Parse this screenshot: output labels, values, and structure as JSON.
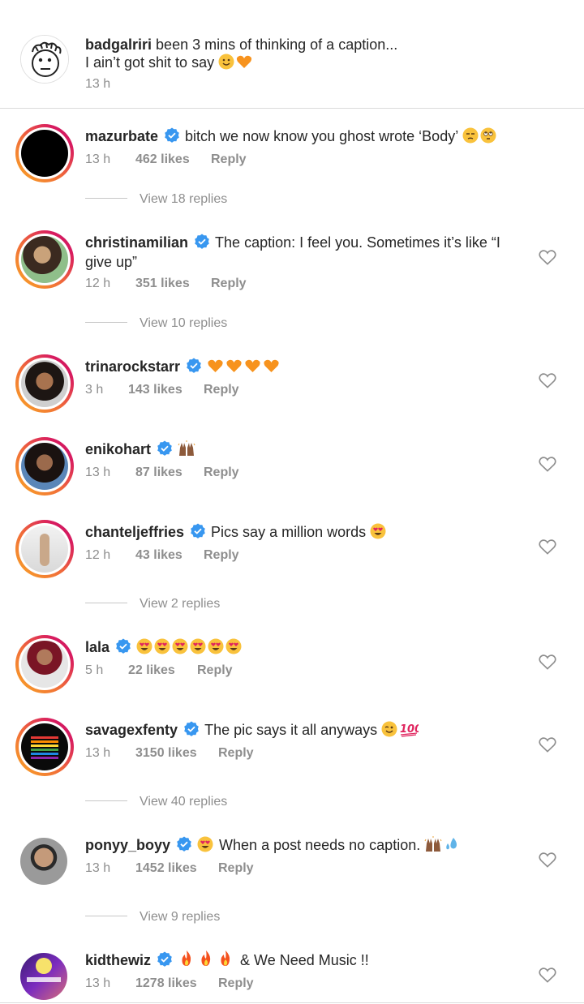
{
  "caption": {
    "username": "badgalriri",
    "text_line1": "been 3 mins of thinking of a caption...",
    "text_line2": "I ain’t got shit to say",
    "time": "13 h",
    "avatar_icon": "cartoon-face-icon"
  },
  "comments": [
    {
      "username": "mazurbate",
      "text": "bitch we now know you ghost wrote ‘Body’",
      "time": "13 h",
      "likes": "462 likes",
      "reply": "Reply",
      "view_replies": "View 18 replies",
      "emojis": [
        "unamused-face-icon",
        "eye-roll-face-icon"
      ]
    },
    {
      "username": "christinamilian",
      "text_line1": "The caption: I feel you. Sometimes it’s like “I",
      "text_line2": "give up”",
      "time": "12 h",
      "likes": "351 likes",
      "reply": "Reply",
      "view_replies": "View 10 replies"
    },
    {
      "username": "trinarockstarr",
      "text": "",
      "time": "3 h",
      "likes": "143 likes",
      "reply": "Reply",
      "emojis": [
        "orange-heart-icon",
        "orange-heart-icon",
        "orange-heart-icon",
        "orange-heart-icon"
      ]
    },
    {
      "username": "enikohart",
      "text": "",
      "time": "13 h",
      "likes": "87 likes",
      "reply": "Reply",
      "emojis": [
        "raised-hands-icon"
      ]
    },
    {
      "username": "chanteljeffries",
      "text": "Pics say a million words",
      "time": "12 h",
      "likes": "43 likes",
      "reply": "Reply",
      "view_replies": "View 2 replies",
      "emojis": [
        "heart-eyes-face-icon"
      ]
    },
    {
      "username": "lala",
      "text": "",
      "time": "5 h",
      "likes": "22 likes",
      "reply": "Reply",
      "emojis": [
        "heart-eyes-face-icon",
        "heart-eyes-face-icon",
        "heart-eyes-face-icon",
        "heart-eyes-face-icon",
        "heart-eyes-face-icon",
        "heart-eyes-face-icon"
      ]
    },
    {
      "username": "savagexfenty",
      "text": "The pic says it all anyways",
      "time": "13 h",
      "likes": "3150 likes",
      "reply": "Reply",
      "view_replies": "View 40 replies",
      "emojis": [
        "winking-face-icon",
        "hundred-points-icon"
      ]
    },
    {
      "username": "ponyy_boyy",
      "text": "When a post needs no caption.",
      "time": "13 h",
      "likes": "1452 likes",
      "reply": "Reply",
      "view_replies": "View 9 replies",
      "emojis": [
        "heart-eyes-face-icon",
        "raised-hands-icon",
        "sweat-droplets-icon"
      ]
    },
    {
      "username": "kidthewiz",
      "text": "&  We Need Music !!",
      "time": "13 h",
      "likes": "1278 likes",
      "reply": "Reply",
      "emojis": [
        "fire-icon",
        "fire-icon",
        "fire-icon"
      ]
    }
  ],
  "colors": {
    "text": "#262626",
    "muted": "#8e8e8e",
    "verified_blue": "#3897f0",
    "divider": "#dbdbdb",
    "orange_heart": "#f7931e",
    "emoji_yellow": "#f9c23c"
  }
}
